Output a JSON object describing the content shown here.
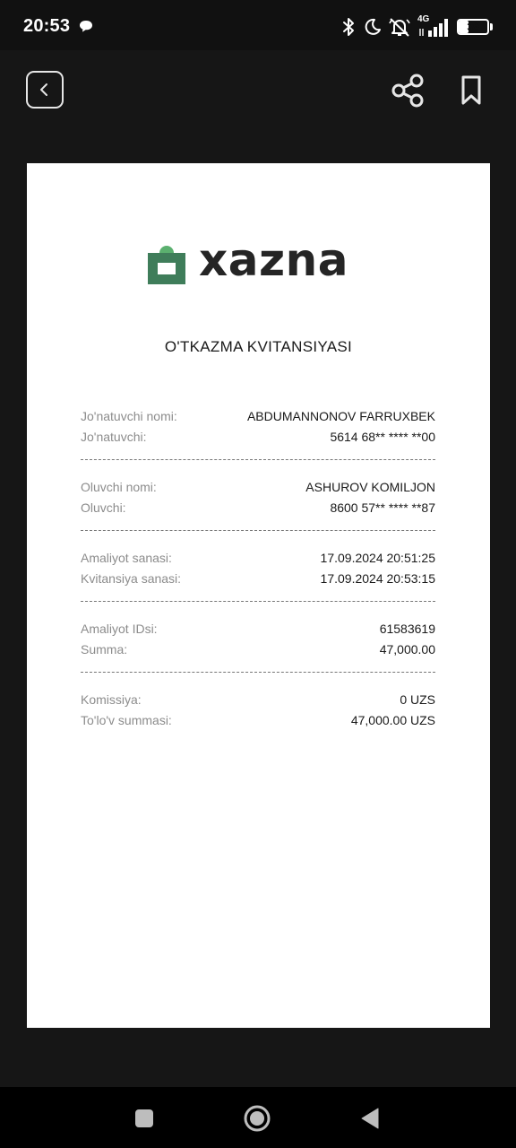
{
  "status_bar": {
    "time": "20:53",
    "network": "4G",
    "battery": "39",
    "battery_level": 0.39
  },
  "header": {
    "back_icon": "chevron-left-icon",
    "share_icon": "share-icon",
    "bookmark_icon": "bookmark-icon"
  },
  "receipt": {
    "logo_text": "xazna",
    "logo_color": "#3f7d5a",
    "title": "O'TKAZMA KVITANSIYASI",
    "sections": [
      [
        {
          "label": "Jo'natuvchi nomi:",
          "value": "ABDUMANNONOV FARRUXBEK"
        },
        {
          "label": "Jo'natuvchi:",
          "value": "5614 68** **** **00"
        }
      ],
      [
        {
          "label": "Oluvchi nomi:",
          "value": "ASHUROV KOMILJON"
        },
        {
          "label": "Oluvchi:",
          "value": "8600 57** **** **87"
        }
      ],
      [
        {
          "label": "Amaliyot sanasi:",
          "value": "17.09.2024 20:51:25"
        },
        {
          "label": "Kvitansiya sanasi:",
          "value": "17.09.2024 20:53:15"
        }
      ],
      [
        {
          "label": "Amaliyot IDsi:",
          "value": "61583619"
        },
        {
          "label": "Summa:",
          "value": "47,000.00"
        }
      ],
      [
        {
          "label": "Komissiya:",
          "value": "0 UZS"
        },
        {
          "label": "To'lo'v summasi:",
          "value": "47,000.00 UZS"
        }
      ]
    ]
  },
  "nav": {
    "recents_icon": "square-icon",
    "home_icon": "circle-icon",
    "back_icon": "triangle-back-icon"
  }
}
